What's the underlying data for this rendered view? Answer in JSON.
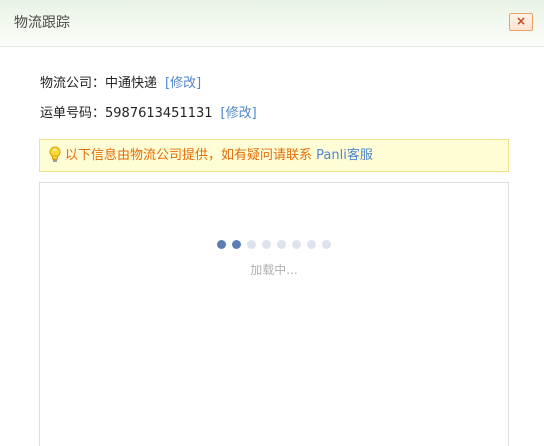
{
  "dialog": {
    "title": "物流跟踪",
    "close_label": "×"
  },
  "shipping": {
    "company_label": "物流公司：",
    "company_value": "中通快递",
    "company_edit": "[修改]",
    "waybill_label": "运单号码：",
    "waybill_value": "5987613451131",
    "waybill_edit": "[修改]"
  },
  "notice": {
    "icon": "lightbulb-icon",
    "text": "以下信息由物流公司提供，如有疑问请联系 ",
    "link": "Panli客服"
  },
  "tracking": {
    "loading_text": "加载中...",
    "dots_total": 8,
    "dots_active": 2
  },
  "colors": {
    "accent": "#4f87c9",
    "notice_text": "#e36c09",
    "notice_bg": "#fffdd6",
    "close_border": "#e8a26b",
    "dot_active": "#5b7db4",
    "dot_inactive": "#dde3ee"
  }
}
